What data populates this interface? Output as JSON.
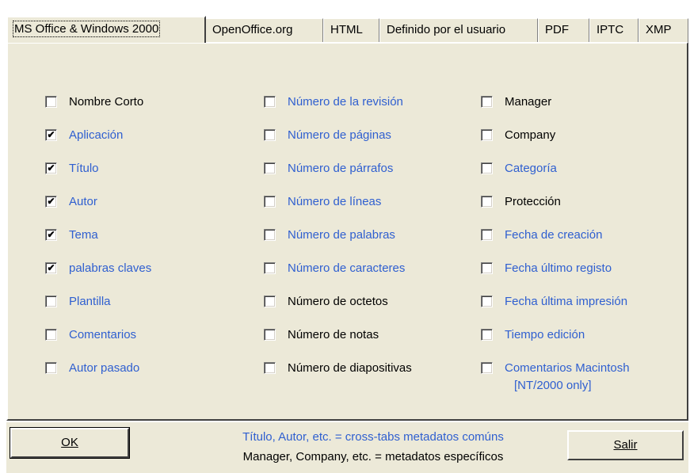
{
  "tabs": [
    {
      "label": "MS Office & Windows 2000",
      "active": true
    },
    {
      "label": "OpenOffice.org",
      "active": false
    },
    {
      "label": "HTML",
      "active": false
    },
    {
      "label": "Definido por el usuario",
      "active": false
    },
    {
      "label": "PDF",
      "active": false
    },
    {
      "label": "IPTC",
      "active": false
    },
    {
      "label": "XMP",
      "active": false
    }
  ],
  "columns": [
    [
      {
        "label": "Nombre Corto",
        "checked": false,
        "color": "black"
      },
      {
        "label": "Aplicación",
        "checked": true,
        "color": "blue"
      },
      {
        "label": "Título",
        "checked": true,
        "color": "blue"
      },
      {
        "label": "Autor",
        "checked": true,
        "color": "blue"
      },
      {
        "label": "Tema",
        "checked": true,
        "color": "blue"
      },
      {
        "label": "palabras claves",
        "checked": true,
        "color": "blue"
      },
      {
        "label": "Plantilla",
        "checked": false,
        "color": "blue"
      },
      {
        "label": "Comentarios",
        "checked": false,
        "color": "blue"
      },
      {
        "label": "Autor pasado",
        "checked": false,
        "color": "blue"
      }
    ],
    [
      {
        "label": "Número de la revisión",
        "checked": false,
        "color": "blue"
      },
      {
        "label": "Número de páginas",
        "checked": false,
        "color": "blue"
      },
      {
        "label": "Número de párrafos",
        "checked": false,
        "color": "blue"
      },
      {
        "label": "Número de líneas",
        "checked": false,
        "color": "blue"
      },
      {
        "label": "Número de palabras",
        "checked": false,
        "color": "blue"
      },
      {
        "label": "Número de caracteres",
        "checked": false,
        "color": "blue"
      },
      {
        "label": "Número de octetos",
        "checked": false,
        "color": "black"
      },
      {
        "label": "Número de notas",
        "checked": false,
        "color": "black"
      },
      {
        "label": "Número de diapositivas",
        "checked": false,
        "color": "black"
      }
    ],
    [
      {
        "label": "Manager",
        "checked": false,
        "color": "black"
      },
      {
        "label": "Company",
        "checked": false,
        "color": "black"
      },
      {
        "label": "Categoría",
        "checked": false,
        "color": "blue"
      },
      {
        "label": "Protección",
        "checked": false,
        "color": "black"
      },
      {
        "label": "Fecha de creación",
        "checked": false,
        "color": "blue"
      },
      {
        "label": "Fecha último registo",
        "checked": false,
        "color": "blue"
      },
      {
        "label": "Fecha última impresión",
        "checked": false,
        "color": "blue"
      },
      {
        "label": "Tiempo edición",
        "checked": false,
        "color": "blue"
      },
      {
        "label": "Comentarios Macintosh",
        "label2": "[NT/2000 only]",
        "checked": false,
        "color": "blue"
      }
    ]
  ],
  "buttons": {
    "ok": "OK",
    "exit": "Salir"
  },
  "notes": {
    "line1": "Título, Autor, etc. = cross-tabs metadatos comúns",
    "line2": "Manager, Company, etc. = metadatos específicos"
  },
  "colors": {
    "blue_text": "#2f5fd0",
    "dialog_bg": "#ece9d8"
  }
}
